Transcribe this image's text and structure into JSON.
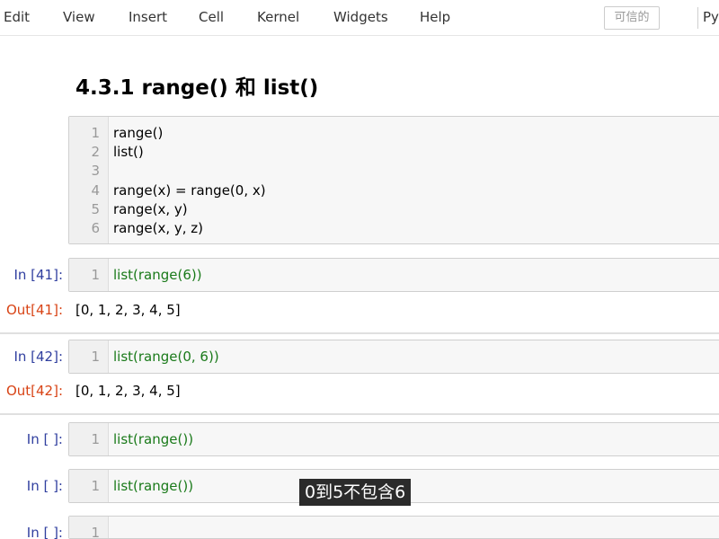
{
  "menu": {
    "items": [
      "Edit",
      "View",
      "Insert",
      "Cell",
      "Kernel",
      "Widgets",
      "Help"
    ],
    "trusted_label": "可信的",
    "kernel_label": "Py"
  },
  "notebook": {
    "heading": "4.3.1 range() 和 list()",
    "markdown_cell": {
      "lines": [
        {
          "num": "1",
          "text": "range()"
        },
        {
          "num": "2",
          "text": "list()"
        },
        {
          "num": "3",
          "text": ""
        },
        {
          "num": "4",
          "text": "range(x) = range(0, x)"
        },
        {
          "num": "5",
          "text": "range(x, y)"
        },
        {
          "num": "6",
          "text": "range(x, y, z)"
        }
      ]
    },
    "cells": [
      {
        "in_prompt": "In [41]:",
        "line_num": "1",
        "code": "list(range(6))",
        "out_prompt": "Out[41]:",
        "output": "[0, 1, 2, 3, 4, 5]"
      },
      {
        "in_prompt": "In [42]:",
        "line_num": "1",
        "code": "list(range(0, 6))",
        "out_prompt": "Out[42]:",
        "output": "[0, 1, 2, 3, 4, 5]"
      },
      {
        "in_prompt": "In [ ]:",
        "line_num": "1",
        "code": "list(range())"
      },
      {
        "in_prompt": "In [ ]:",
        "line_num": "1",
        "code": "list(range())"
      },
      {
        "in_prompt": "In [ ]:",
        "line_num": "1",
        "code": ""
      }
    ]
  },
  "subtitle": "0到5不包含6",
  "colors": {
    "in_prompt": "#303f9f",
    "out_prompt": "#d84315",
    "code_green": "#1a7a1a"
  }
}
